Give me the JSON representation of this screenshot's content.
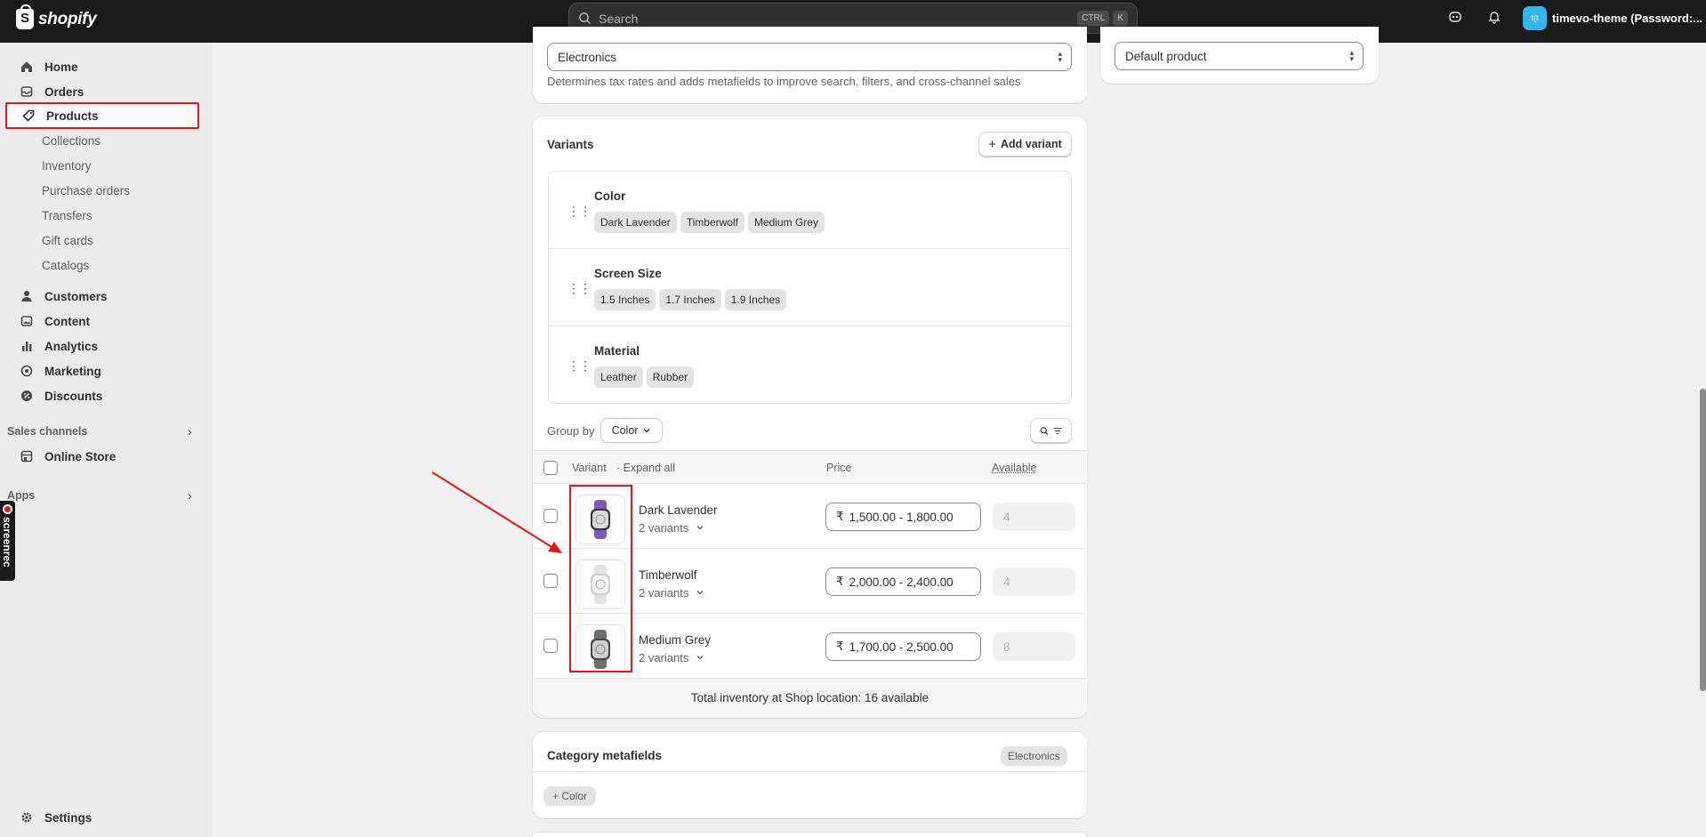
{
  "topbar": {
    "logo_text": "shopify",
    "search_placeholder": "Search",
    "shortcut_keys": [
      "CTRL",
      "K"
    ],
    "store_initials": "t(t",
    "store_name": "timevo-theme (Password:..."
  },
  "sidebar": {
    "items": [
      {
        "label": "Home",
        "icon": "home-icon"
      },
      {
        "label": "Orders",
        "icon": "inbox-icon"
      },
      {
        "label": "Products",
        "icon": "tag-icon"
      },
      {
        "label": "Customers",
        "icon": "person-icon"
      },
      {
        "label": "Content",
        "icon": "image-icon"
      },
      {
        "label": "Analytics",
        "icon": "bar-chart-icon"
      },
      {
        "label": "Marketing",
        "icon": "target-icon"
      },
      {
        "label": "Discounts",
        "icon": "discount-icon"
      },
      {
        "label": "Online Store",
        "icon": "store-icon"
      },
      {
        "label": "Settings",
        "icon": "gear-icon"
      }
    ],
    "product_subitems": [
      "Collections",
      "Inventory",
      "Purchase orders",
      "Transfers",
      "Gift cards",
      "Catalogs"
    ],
    "sales_channels_title": "Sales channels",
    "apps_title": "Apps",
    "screenrec_label": "screenrec"
  },
  "category": {
    "value": "Electronics",
    "help": "Determines tax rates and adds metafields to improve search, filters, and cross-channel sales"
  },
  "product_type_select": {
    "value": "Default product"
  },
  "variants": {
    "title": "Variants",
    "add_button": "Add variant",
    "options": [
      {
        "name": "Color",
        "values": [
          "Dark Lavender",
          "Timberwolf",
          "Medium Grey"
        ]
      },
      {
        "name": "Screen Size",
        "values": [
          "1.5 Inches",
          "1.7 Inches",
          "1.9 Inches"
        ]
      },
      {
        "name": "Material",
        "values": [
          "Leather",
          "Rubber"
        ]
      }
    ],
    "group_by_label": "Group by",
    "group_by_value": "Color",
    "columns": {
      "variant": "Variant",
      "expand_all": "· Expand all",
      "price": "Price",
      "available": "Available"
    },
    "rows": [
      {
        "name": "Dark Lavender",
        "count": "2 variants",
        "currency": "₹",
        "price": "1,500.00 - 1,800.00",
        "available": "4",
        "band_color": "#7a5cb8"
      },
      {
        "name": "Timberwolf",
        "count": "2 variants",
        "currency": "₹",
        "price": "2,000.00 - 2,400.00",
        "available": "4",
        "band_color": "#e2e2e2"
      },
      {
        "name": "Medium Grey",
        "count": "2 variants",
        "currency": "₹",
        "price": "1,700.00 - 2,500.00",
        "available": "8",
        "band_color": "#6f6f6f"
      }
    ],
    "total_inventory": "Total inventory at Shop location: 16 available"
  },
  "category_metafields": {
    "title": "Category metafields",
    "badge": "Electronics",
    "add_color": "Color"
  }
}
